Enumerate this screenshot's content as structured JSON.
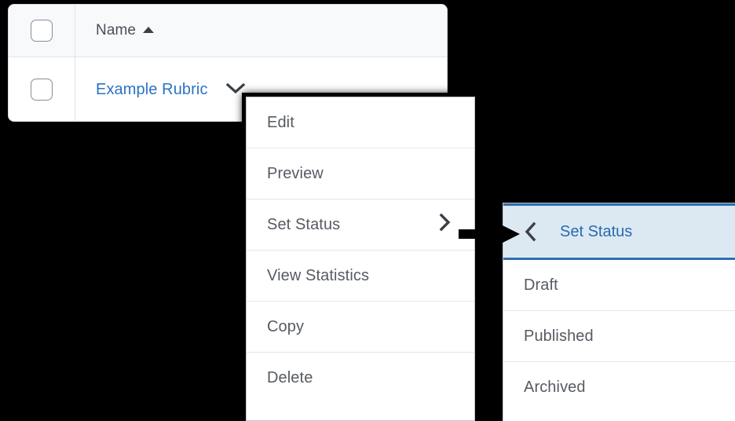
{
  "table": {
    "columns": [
      {
        "key": "select",
        "label": "",
        "icon": "checkbox-icon"
      },
      {
        "key": "name",
        "label": "Name",
        "sort": "ascending",
        "sort_icon": "sort-ascending-icon"
      }
    ],
    "header": {
      "select_all_checkbox": "select-all-checkbox",
      "name_label": "Name"
    },
    "rows": [
      {
        "checkbox": "row-checkbox",
        "name": "Example Rubric",
        "menu_toggle_icon": "chevron-down-icon"
      }
    ]
  },
  "context_menu": {
    "name": "rubric-context-menu",
    "items": [
      {
        "label": "Edit",
        "has_submenu": false
      },
      {
        "label": "Preview",
        "has_submenu": false
      },
      {
        "label": "Set Status",
        "has_submenu": true,
        "submenu_icon": "chevron-right-icon"
      },
      {
        "label": "View Statistics",
        "has_submenu": false
      },
      {
        "label": "Copy",
        "has_submenu": false
      },
      {
        "label": "Delete",
        "has_submenu": false
      }
    ]
  },
  "submenu": {
    "name": "set-status-submenu",
    "header": {
      "label": "Set Status",
      "back_icon": "chevron-left-icon"
    },
    "items": [
      {
        "label": "Draft"
      },
      {
        "label": "Published"
      },
      {
        "label": "Archived"
      }
    ]
  },
  "annotation": {
    "arrow": "right-arrow-callout"
  },
  "colors": {
    "link": "#2a73c4",
    "menu_text": "#565b62",
    "submenu_header_bg": "#dce9f3",
    "submenu_header_border": "#2f6fae",
    "submenu_header_text": "#2a6ab0",
    "table_header_bg": "#f7f9fb",
    "table_border": "#dfe3ea",
    "background": "#000000"
  }
}
